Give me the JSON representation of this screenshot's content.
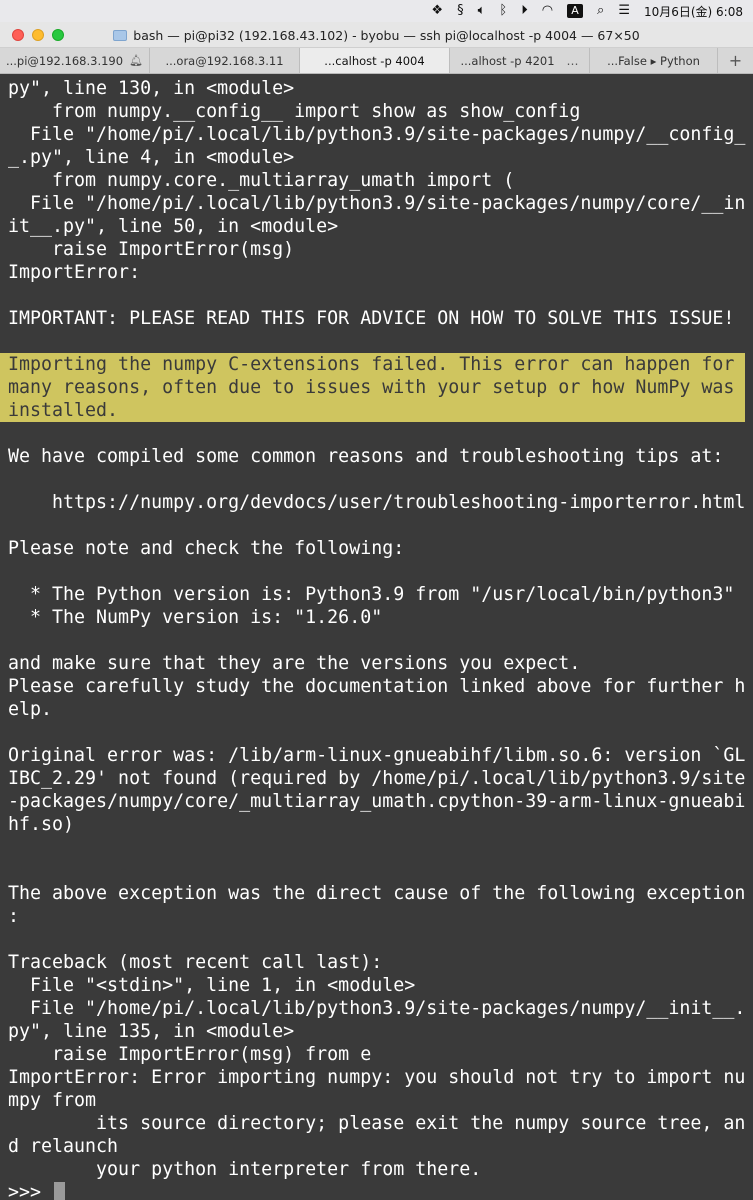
{
  "menubar": {
    "clock": "10月6日(金)  6:08",
    "input_source": "A",
    "icons": [
      "dropbox-icon",
      "scripting-icon",
      "volume-icon",
      "bluetooth-icon",
      "play-icon",
      "wifi-icon",
      "input-source-icon",
      "search-icon",
      "control-center-icon"
    ]
  },
  "window": {
    "title": "bash — pi@pi32 (192.168.43.102) - byobu — ssh pi@localhost -p 4004 — 67×50"
  },
  "tabs": [
    {
      "label": "...pi@192.168.3.190",
      "active": false,
      "has_bell": true
    },
    {
      "label": "...ora@192.168.3.11",
      "active": false
    },
    {
      "label": "...calhost -p 4004",
      "active": true
    },
    {
      "label": "...alhost -p 4201",
      "active": false,
      "has_more": true
    },
    {
      "label": "...False ▸ Python",
      "active": false
    }
  ],
  "new_tab_label": "+",
  "terminal": {
    "lines": [
      "py\", line 130, in <module>",
      "    from numpy.__config__ import show as show_config",
      "  File \"/home/pi/.local/lib/python3.9/site-packages/numpy/__config_",
      "_.py\", line 4, in <module>",
      "    from numpy.core._multiarray_umath import (",
      "  File \"/home/pi/.local/lib/python3.9/site-packages/numpy/core/__in",
      "it__.py\", line 50, in <module>",
      "    raise ImportError(msg)",
      "ImportError:",
      "",
      "IMPORTANT: PLEASE READ THIS FOR ADVICE ON HOW TO SOLVE THIS ISSUE!",
      "",
      "Importing the numpy C-extensions failed. This error can happen for",
      "many reasons, often due to issues with your setup or how NumPy was",
      "installed.",
      "",
      "We have compiled some common reasons and troubleshooting tips at:",
      "",
      "    https://numpy.org/devdocs/user/troubleshooting-importerror.html",
      "",
      "Please note and check the following:",
      "",
      "  * The Python version is: Python3.9 from \"/usr/local/bin/python3\"",
      "  * The NumPy version is: \"1.26.0\"",
      "",
      "and make sure that they are the versions you expect.",
      "Please carefully study the documentation linked above for further h",
      "elp.",
      "",
      "Original error was: /lib/arm-linux-gnueabihf/libm.so.6: version `GL",
      "IBC_2.29' not found (required by /home/pi/.local/lib/python3.9/site",
      "-packages/numpy/core/_multiarray_umath.cpython-39-arm-linux-gnueabi",
      "hf.so)",
      "",
      "",
      "The above exception was the direct cause of the following exception",
      ":",
      "",
      "Traceback (most recent call last):",
      "  File \"<stdin>\", line 1, in <module>",
      "  File \"/home/pi/.local/lib/python3.9/site-packages/numpy/__init__.",
      "py\", line 135, in <module>",
      "    raise ImportError(msg) from e",
      "ImportError: Error importing numpy: you should not try to import nu",
      "mpy from",
      "        its source directory; please exit the numpy source tree, an",
      "d relaunch",
      "        your python interpreter from there."
    ],
    "highlighted_lines": [
      12,
      13,
      14
    ],
    "prompt": ">>> "
  },
  "colors": {
    "terminal_bg": "#3a3a3a",
    "terminal_fg": "#ffffff",
    "highlight_bg": "#cfc55f",
    "highlight_fg": "#3a3a3a"
  }
}
